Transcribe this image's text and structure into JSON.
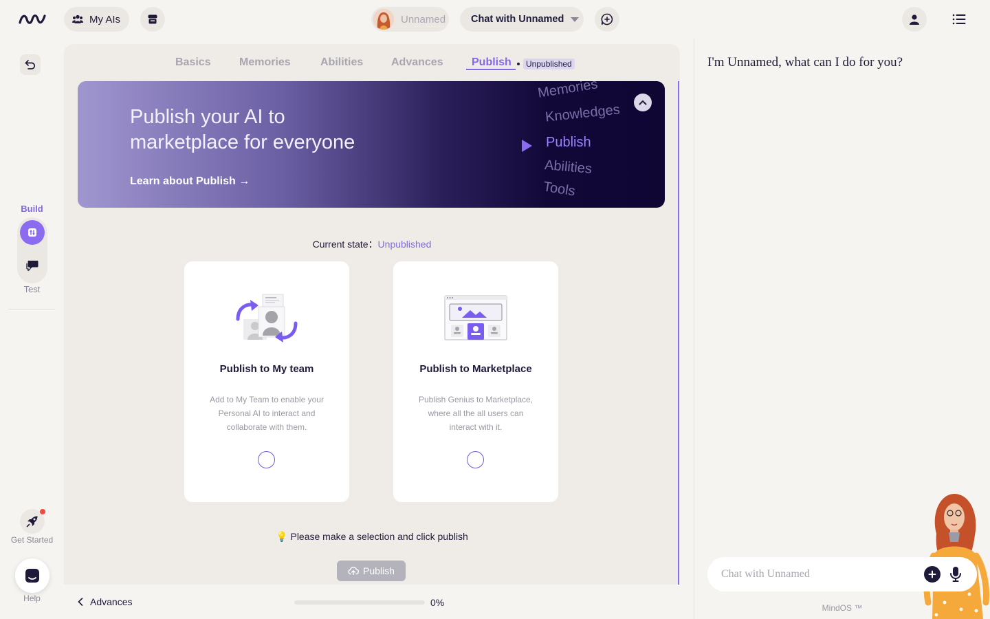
{
  "topbar": {
    "my_ais_label": "My AIs",
    "ai_name": "Unnamed",
    "chat_selector_label": "Chat with Unnamed"
  },
  "rail": {
    "build_label": "Build",
    "test_label": "Test",
    "get_started_label": "Get Started",
    "help_label": "Help"
  },
  "tabs": {
    "items": [
      {
        "label": "Basics"
      },
      {
        "label": "Memories"
      },
      {
        "label": "Abilities"
      },
      {
        "label": "Advances"
      },
      {
        "label": "Publish"
      }
    ],
    "active": "Publish",
    "badge": "Unpublished"
  },
  "hero": {
    "title_line1": "Publish your AI to",
    "title_line2": "marketplace for everyone",
    "link": "Learn about Publish →",
    "words": [
      "Memories",
      "Knowledges",
      "Publish",
      "Abilities",
      "Tools"
    ],
    "active_word": "Publish"
  },
  "state": {
    "label": "Current state：",
    "value": "Unpublished"
  },
  "cards": [
    {
      "title": "Publish to My team",
      "description": "Add to My Team to enable your Personal AI to interact and collaborate with them."
    },
    {
      "title": "Publish to Marketplace",
      "description": "Publish Genius to Marketplace, where all the all users can interact with it."
    }
  ],
  "hint": "💡 Please make a selection and click publish",
  "publish_button": "Publish",
  "bottombar": {
    "prev_label": "Advances",
    "progress_text": "0%",
    "progress_value": 0
  },
  "chat": {
    "greeting": "I'm Unnamed, what can I do for you?",
    "input_placeholder": "Chat with Unnamed",
    "footer": "MindOS ™"
  },
  "colors": {
    "accent": "#8467e8",
    "background": "#f6f4f1",
    "panel": "#efece8",
    "text": "#1e1a3a"
  }
}
